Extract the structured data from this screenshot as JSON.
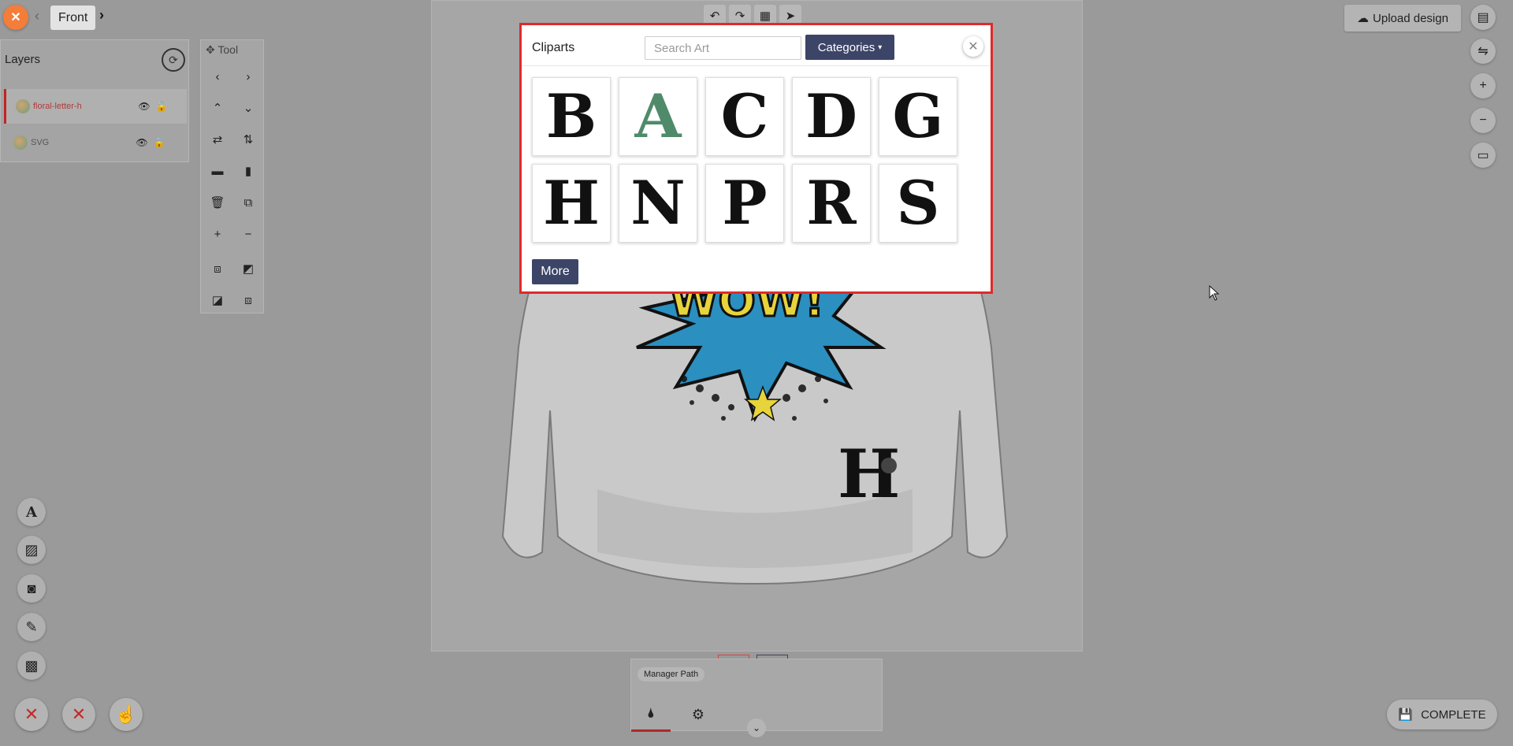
{
  "nav": {
    "close_icon": "close-icon",
    "view_label": "Front"
  },
  "layers": {
    "title": "Layers",
    "items": [
      {
        "name": "floral-letter-h",
        "active": true
      },
      {
        "name": "SVG",
        "active": false
      }
    ]
  },
  "tool": {
    "title": "Tool"
  },
  "canvas_toolbar": [
    "undo-icon",
    "redo-icon",
    "grid-icon",
    "pointer-icon"
  ],
  "upload": {
    "label": "Upload design"
  },
  "path_panel": {
    "label": "Manager Path"
  },
  "complete": {
    "label": "COMPLETE"
  },
  "cliparts": {
    "title": "Cliparts",
    "search_placeholder": "Search Art",
    "categories_label": "Categories",
    "more_label": "More",
    "items": [
      {
        "letter": "B",
        "color": "#111111"
      },
      {
        "letter": "A",
        "color": "#4f8b6a"
      },
      {
        "letter": "C",
        "color": "#111111"
      },
      {
        "letter": "D",
        "color": "#111111"
      },
      {
        "letter": "G",
        "color": "#111111"
      },
      {
        "letter": "H",
        "color": "#111111"
      },
      {
        "letter": "N",
        "color": "#111111"
      },
      {
        "letter": "P",
        "color": "#111111"
      },
      {
        "letter": "R",
        "color": "#111111"
      },
      {
        "letter": "S",
        "color": "#111111"
      }
    ]
  },
  "colors": {
    "accent": "#3c4568",
    "modal_border": "#e02a2a",
    "close_orange": "#f47d3a",
    "danger": "#c62828"
  }
}
